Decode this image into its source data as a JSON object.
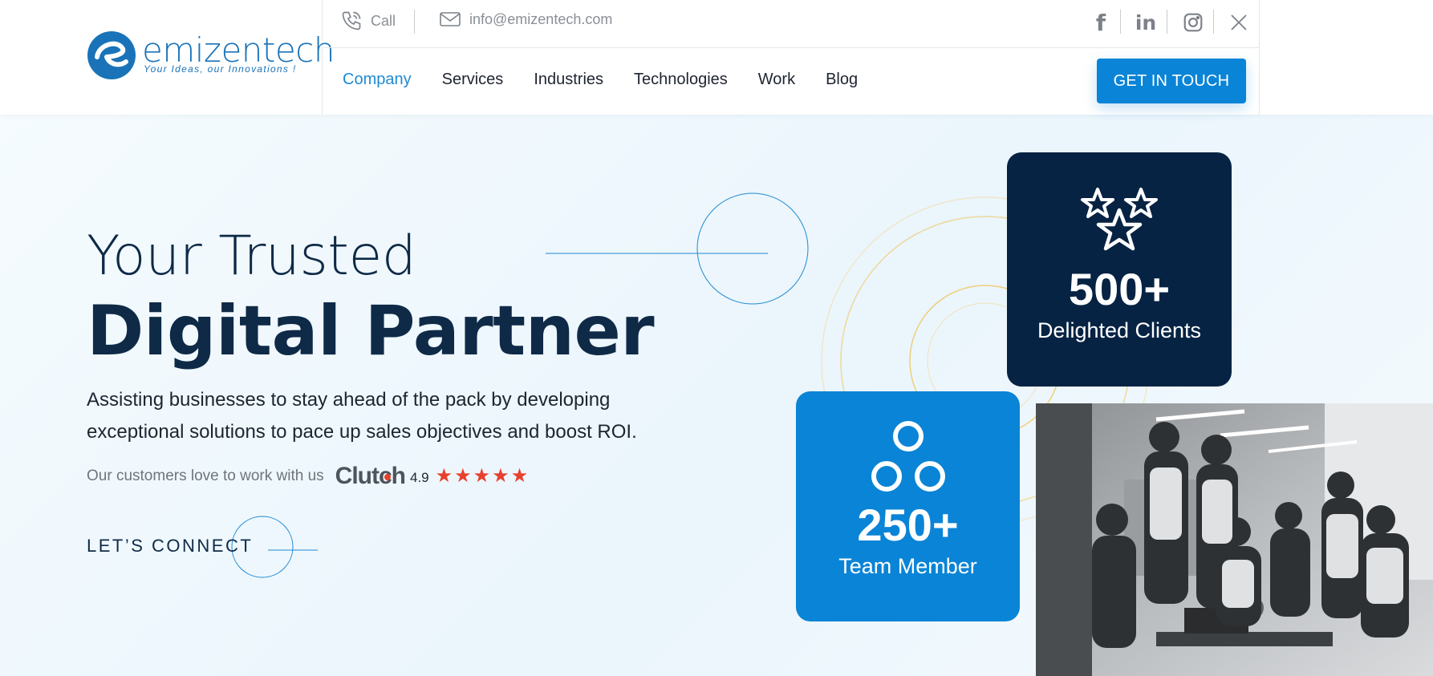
{
  "header": {
    "logo": {
      "word": "emizentech",
      "tagline": "Your Ideas, our Innovations !"
    },
    "call_label": "Call",
    "email": "info@emizentech.com",
    "social": [
      {
        "icon": "facebook-icon"
      },
      {
        "icon": "linkedin-icon"
      },
      {
        "icon": "instagram-icon"
      },
      {
        "icon": "x-twitter-icon"
      }
    ],
    "nav": [
      "Company",
      "Services",
      "Industries",
      "Technologies",
      "Work",
      "Blog"
    ],
    "active_nav": "Company",
    "cta": "GET IN TOUCH"
  },
  "hero": {
    "title_line1": "Your Trusted",
    "title_line2": "Digital Partner",
    "subtext": "Assisting businesses to stay ahead of the pack by developing exceptional solutions to pace up sales objectives and boost ROI.",
    "clutch_label": "Our customers love to work with us",
    "clutch_logo": "Clutch",
    "clutch_score": "4.9",
    "clutch_stars": 5,
    "connect_label": "LET’S CONNECT"
  },
  "stats": {
    "clients": {
      "number": "500+",
      "caption": "Delighted Clients",
      "icon": "stars-icon"
    },
    "team": {
      "number": "250+",
      "caption": "Team Member",
      "icon": "team-circles-icon"
    }
  },
  "colors": {
    "primary": "#0a84d6",
    "navy": "#072343",
    "heading": "#0e2a47",
    "star": "#e8402e"
  }
}
